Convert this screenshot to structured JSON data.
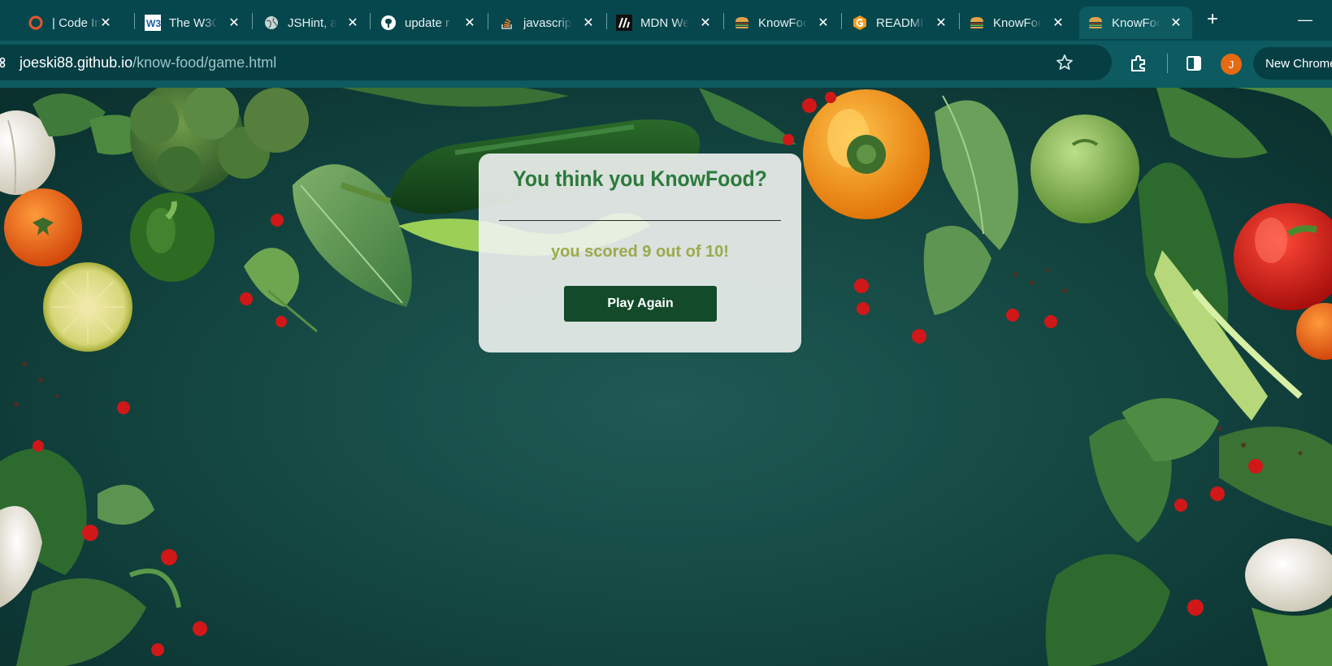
{
  "tabs": [
    {
      "title": "| Code In",
      "icon": "codeinstitute-icon"
    },
    {
      "title": "The W3C",
      "icon": "w3c-icon"
    },
    {
      "title": "JSHint, a",
      "icon": "globe-icon"
    },
    {
      "title": "update r",
      "icon": "github-icon"
    },
    {
      "title": "javascrip",
      "icon": "stackoverflow-icon"
    },
    {
      "title": "MDN We",
      "icon": "mdn-icon"
    },
    {
      "title": "KnowFoo",
      "icon": "burger-icon"
    },
    {
      "title": "READMI",
      "icon": "readme-icon"
    },
    {
      "title": "KnowFoo",
      "icon": "burger-icon"
    },
    {
      "title": "KnowFoo",
      "icon": "burger-icon",
      "active": true
    }
  ],
  "toolbar": {
    "url_host": "joeski88.github.io",
    "url_path": "/know-food/game.html",
    "avatar_initial": "J",
    "new_chrome_label": "New Chrome"
  },
  "quiz": {
    "title": "You think you KnowFood?",
    "score_text": "you scored 9 out of 10!",
    "play_again_label": "Play Again"
  },
  "colors": {
    "tabstrip": "#06474d",
    "toolbar": "#0d5a60",
    "card_title": "#2b7a3b",
    "score_text": "#9aab4a",
    "button_bg": "#124a2a"
  }
}
